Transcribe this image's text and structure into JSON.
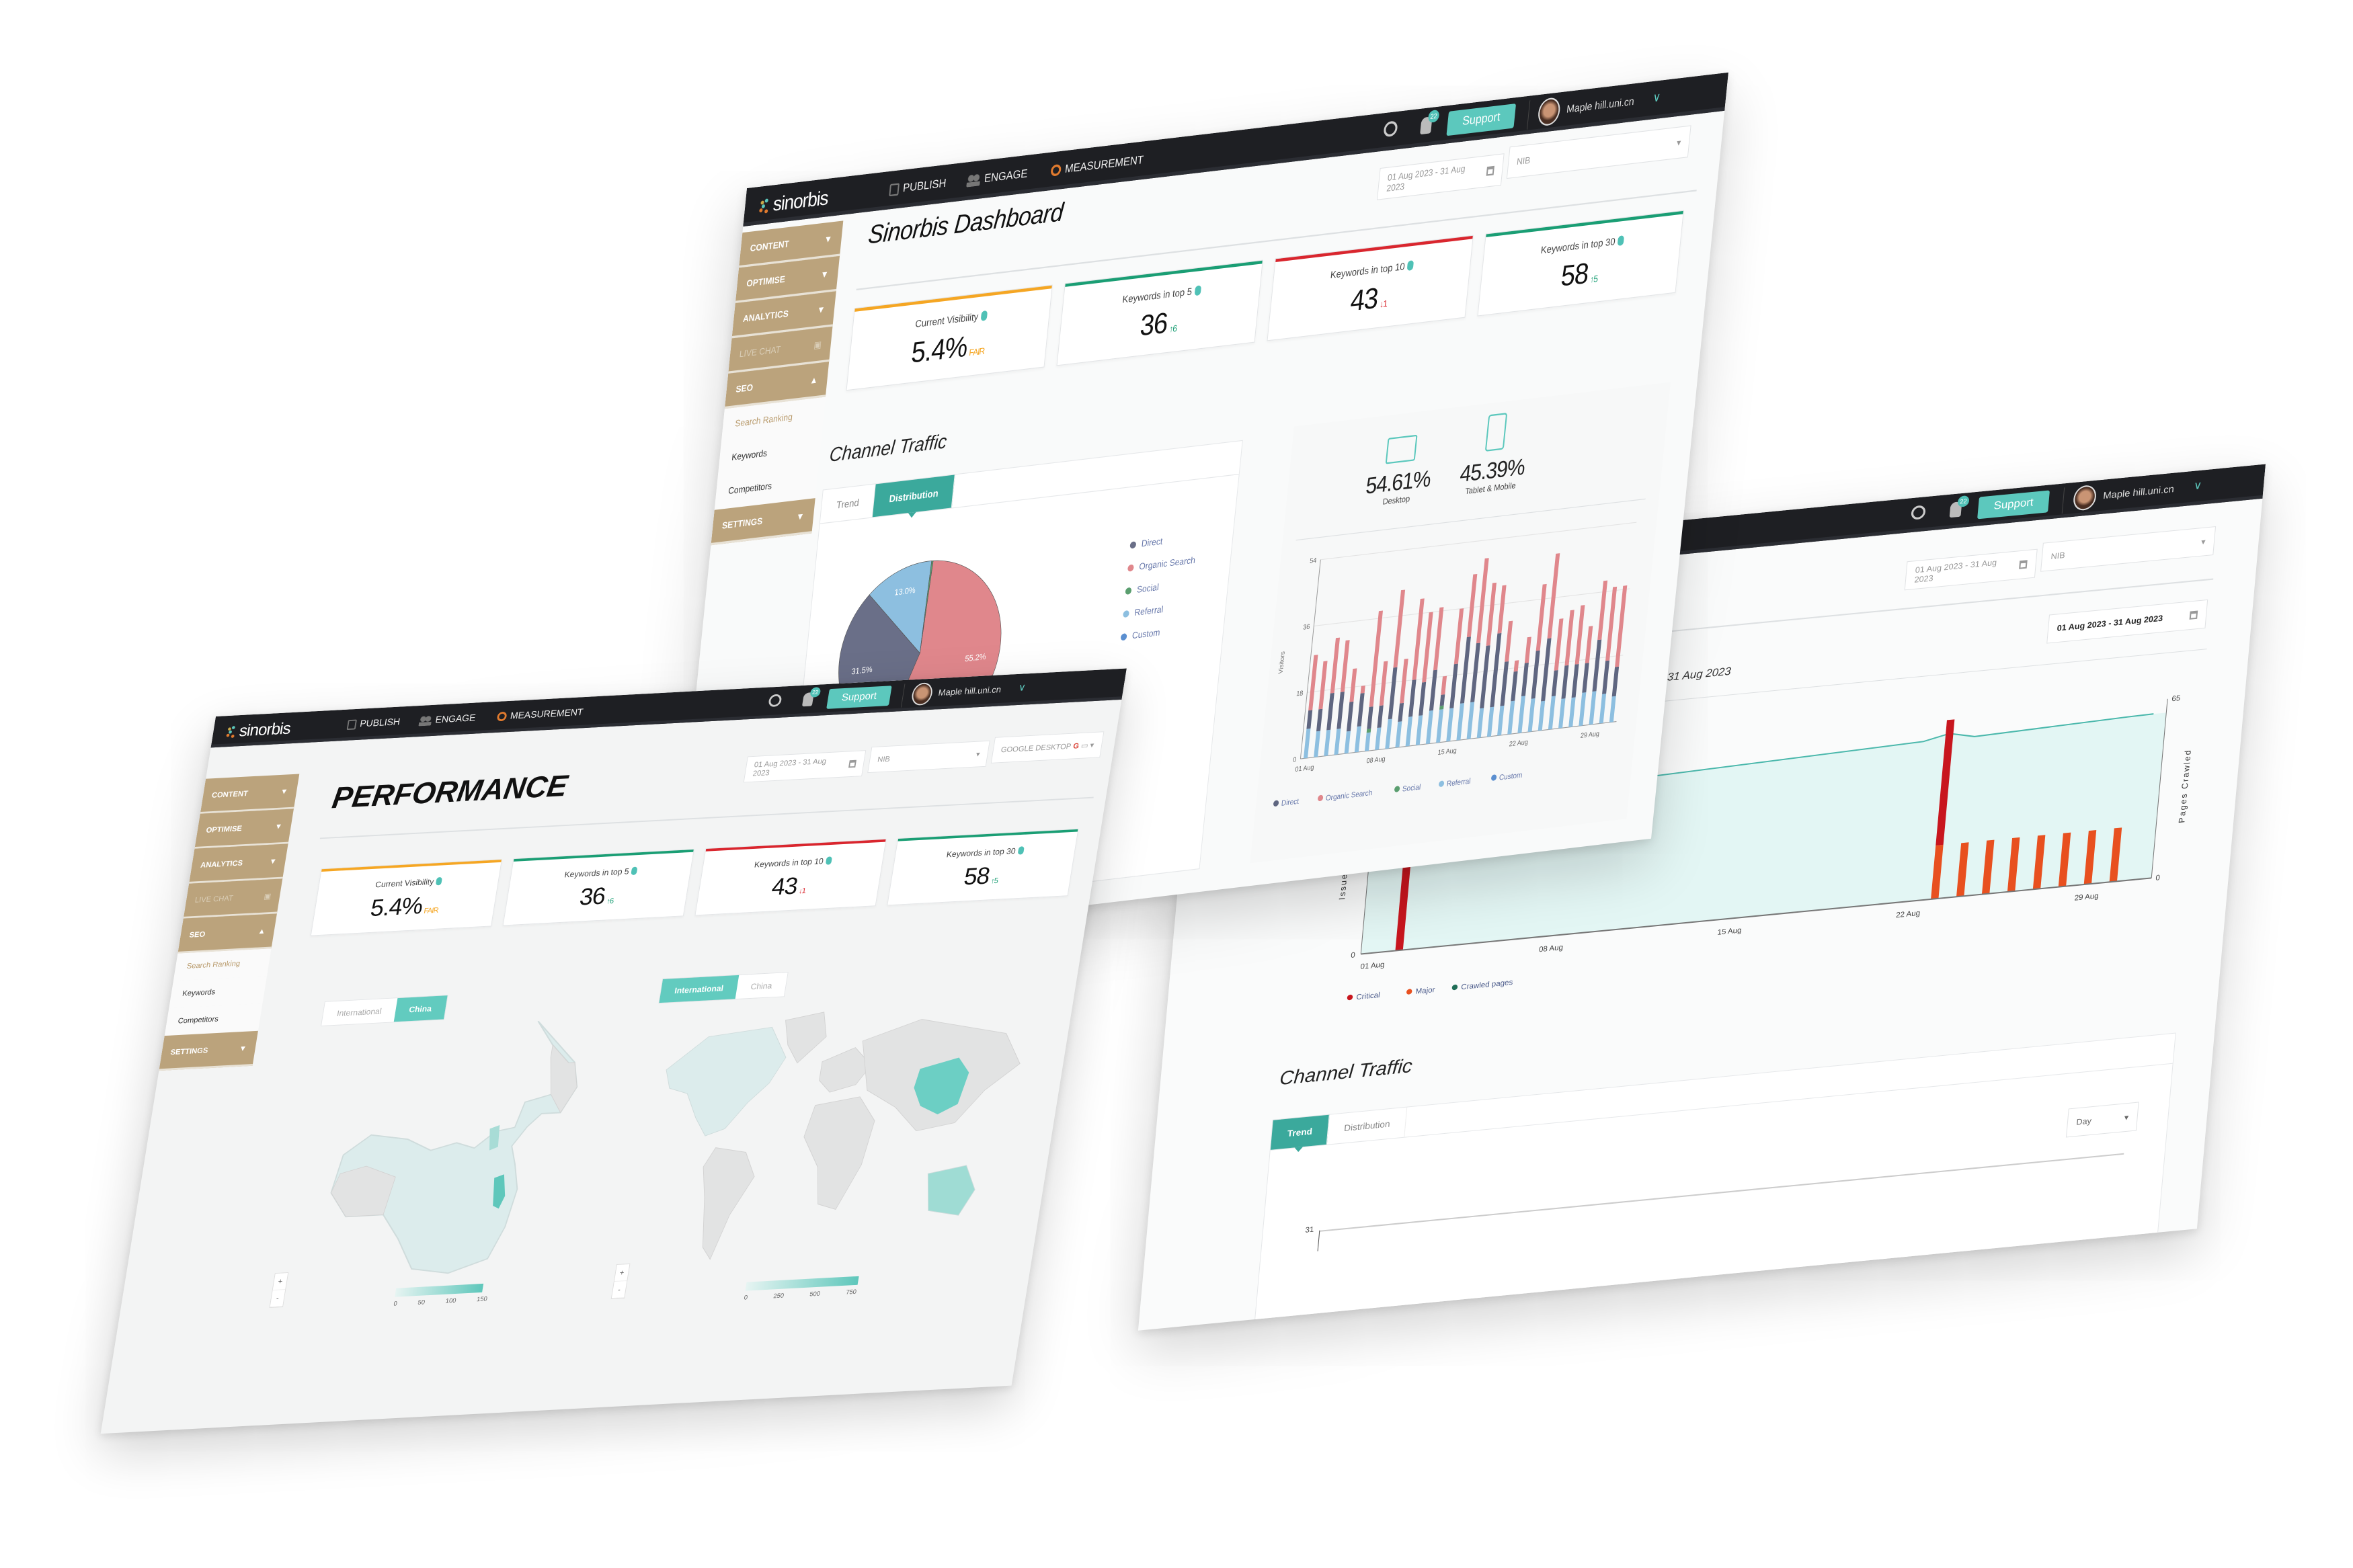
{
  "app": {
    "brand": "sinorbis",
    "nav": [
      {
        "label": "PUBLISH",
        "icon": "publish-icon"
      },
      {
        "label": "ENGAGE",
        "icon": "users-icon"
      },
      {
        "label": "MEASUREMENT",
        "icon": "gear-icon"
      }
    ],
    "notification_count": "22",
    "support_label": "Support",
    "user_name": "Maple hill.uni.cn"
  },
  "sidebar": {
    "sections": [
      {
        "label": "CONTENT",
        "chevron": "down"
      },
      {
        "label": "OPTIMISE",
        "chevron": "down"
      },
      {
        "label": "ANALYTICS",
        "chevron": "down"
      },
      {
        "label": "LIVE CHAT",
        "locked": true
      },
      {
        "label": "SEO",
        "chevron": "up",
        "items": [
          "Search Ranking",
          "Keywords",
          "Competitors"
        ],
        "active_item": "Search Ranking"
      },
      {
        "label": "SETTINGS",
        "chevron": "down"
      }
    ]
  },
  "filters": {
    "date_range": "01 Aug 2023 - 31 Aug 2023",
    "site": "NIB",
    "engine": "GOOGLE DESKTOP"
  },
  "kpis": [
    {
      "label": "Current Visibility",
      "value": "5.4%",
      "delta": "FAIR",
      "trend": "none",
      "color": "#f5a623"
    },
    {
      "label": "Keywords in top 5",
      "value": "36",
      "delta": "6",
      "trend": "up",
      "color": "#1a9e74"
    },
    {
      "label": "Keywords in top 10",
      "value": "43",
      "delta": "1",
      "trend": "down",
      "color": "#d9262e"
    },
    {
      "label": "Keywords in top 30",
      "value": "58",
      "delta": "5",
      "trend": "up",
      "color": "#1a9e74"
    }
  ],
  "dashboard": {
    "title": "Sinorbis Dashboard",
    "channel_traffic": {
      "title": "Channel Traffic",
      "tabs": [
        "Trend",
        "Distribution"
      ],
      "active_tab": "Distribution"
    },
    "devices": [
      {
        "value": "54.61%",
        "label": "Desktop",
        "icon": "desktop-icon"
      },
      {
        "value": "45.39%",
        "label": "Tablet & Mobile",
        "icon": "tablet-mobile-icon"
      }
    ]
  },
  "performance": {
    "title": "PERFORMANCE",
    "china_map": {
      "toggle": [
        "International",
        "China"
      ],
      "active": "China",
      "legend": [
        "0",
        "50",
        "100",
        "150"
      ]
    },
    "world_map": {
      "toggle": [
        "International",
        "China"
      ],
      "active": "International",
      "legend": [
        "0",
        "250",
        "500",
        "750"
      ]
    },
    "zoom": {
      "in": "+",
      "out": "-"
    }
  },
  "site_audit": {
    "date_picker": "01 Aug 2023 - 31 Aug 2023",
    "subtitle": "01 Aug 2023 to 31 Aug 2023",
    "channel_traffic": {
      "title": "Channel Traffic",
      "tabs": [
        "Trend",
        "Distribution"
      ],
      "active_tab": "Trend",
      "granularity": "Day",
      "y_tick": "31"
    }
  },
  "colors": {
    "accent": "#5cc8bd",
    "sidebar": "#bba37c",
    "header": "#1e1f23"
  },
  "chart_data": [
    {
      "type": "pie",
      "labels": [
        "Organic Search",
        "Direct",
        "Referral",
        "Social",
        "Custom"
      ],
      "values": [
        55.2,
        31.5,
        13.0,
        0.3,
        0
      ],
      "value_labels": [
        "55.2%",
        "31.5%",
        "13.0%",
        "",
        ""
      ],
      "colors": [
        "#e0878c",
        "#6a6f88",
        "#8dbfe0",
        "#5a9e6f",
        "#5b8fd0"
      ],
      "legend": [
        "Direct",
        "Organic Search",
        "Social",
        "Referral",
        "Custom"
      ],
      "legend_colors": [
        "#6a6f88",
        "#e0878c",
        "#5a9e6f",
        "#8dbfe0",
        "#5b8fd0"
      ]
    },
    {
      "type": "bar",
      "stacked": true,
      "ylabel": "Visitors",
      "ylim": [
        0,
        54
      ],
      "yticks": [
        "0",
        "18",
        "36",
        "54"
      ],
      "xtick_labels": [
        "01 Aug",
        "08 Aug",
        "15 Aug",
        "22 Aug",
        "29 Aug"
      ],
      "xtick_index": [
        0,
        7,
        14,
        21,
        28
      ],
      "grid": true,
      "legend_position": "bottom",
      "series": [
        {
          "name": "Referral",
          "color": "#8dbfe0",
          "values": [
            8,
            7,
            7,
            7,
            6,
            7,
            5,
            6,
            8,
            7,
            8,
            8,
            9,
            9,
            9,
            10,
            10,
            8,
            8,
            8,
            9,
            10,
            9,
            8,
            9,
            8,
            8,
            9,
            9,
            8,
            7
          ]
        },
        {
          "name": "Social",
          "color": "#5a9e6f",
          "values": [
            0,
            0,
            0,
            0,
            0,
            0,
            1,
            0,
            0,
            0,
            0,
            0,
            0,
            1,
            0,
            0,
            0,
            0,
            0,
            0,
            0,
            0,
            0,
            0,
            0,
            0,
            0,
            0,
            0,
            0,
            0
          ]
        },
        {
          "name": "Direct",
          "color": "#5f6680",
          "values": [
            5,
            6,
            10,
            10,
            8,
            9,
            6,
            6,
            14,
            5,
            10,
            9,
            11,
            3,
            12,
            18,
            16,
            17,
            20,
            12,
            8,
            9,
            13,
            17,
            7,
            9,
            9,
            8,
            14,
            9,
            8
          ]
        },
        {
          "name": "Organic Search",
          "color": "#e0878c",
          "values": [
            15,
            13,
            15,
            14,
            9,
            2,
            26,
            12,
            21,
            12,
            22,
            19,
            17,
            5,
            15,
            17,
            23,
            17,
            13,
            11,
            3,
            7,
            18,
            23,
            14,
            15,
            16,
            10,
            16,
            20,
            22
          ]
        },
        {
          "name": "Custom",
          "color": "#5b8fd0",
          "values": [
            0,
            0,
            0,
            0,
            0,
            0,
            0,
            0,
            0,
            0,
            0,
            0,
            0,
            0,
            0,
            0,
            0,
            0,
            0,
            0,
            0,
            0,
            0,
            0,
            0,
            0,
            0,
            0,
            0,
            0,
            0
          ]
        }
      ],
      "legend": [
        "Direct",
        "Organic Search",
        "Social",
        "Referral",
        "Custom"
      ],
      "legend_colors": [
        "#5f6680",
        "#e0878c",
        "#5a9e6f",
        "#8dbfe0",
        "#5b8fd0"
      ]
    },
    {
      "type": "bar",
      "combo_line": true,
      "ylabel": "Issues Found",
      "y2label": "Pages Crawled",
      "yticks": [
        "0"
      ],
      "y2lim": [
        0,
        65
      ],
      "y2ticks": [
        "0",
        "65"
      ],
      "xtick_labels": [
        "01 Aug",
        "08 Aug",
        "15 Aug",
        "22 Aug",
        "29 Aug"
      ],
      "xtick_index": [
        0,
        7,
        14,
        21,
        28
      ],
      "legend_position": "bottom-left",
      "series": [
        {
          "name": "Critical",
          "color": "#c8161e",
          "values": [
            0,
            40,
            0,
            0,
            0,
            0,
            0,
            0,
            0,
            0,
            0,
            0,
            0,
            0,
            0,
            0,
            0,
            0,
            0,
            0,
            0,
            0,
            28,
            0,
            0,
            0,
            0,
            0,
            0,
            0,
            0
          ]
        },
        {
          "name": "Major",
          "color": "#e8501f",
          "values": [
            0,
            0,
            0,
            0,
            0,
            0,
            0,
            0,
            0,
            0,
            0,
            0,
            0,
            0,
            0,
            0,
            0,
            0,
            0,
            0,
            0,
            0,
            12,
            12,
            12,
            12,
            12,
            12,
            12,
            12,
            0
          ]
        },
        {
          "name": "Crawled pages",
          "color": "#1f6e57",
          "line_color": "#4bb8ac",
          "axis": "right",
          "values": [
            52,
            52,
            52.3,
            52.6,
            52.9,
            53.2,
            53.5,
            53.8,
            54.1,
            54.4,
            54.7,
            55,
            55.3,
            55.6,
            55.9,
            56.2,
            56.5,
            56.8,
            57.1,
            57.4,
            57.7,
            58,
            60,
            58,
            58.3,
            58.6,
            58.9,
            59.2,
            59.5,
            59.8,
            60
          ]
        }
      ],
      "legend": [
        "Critical",
        "Major",
        "Crawled pages"
      ],
      "legend_colors": [
        "#c8161e",
        "#e8501f",
        "#1f6e57"
      ]
    }
  ]
}
